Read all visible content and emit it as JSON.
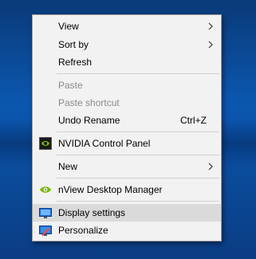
{
  "menu": {
    "items": [
      {
        "label": "View"
      },
      {
        "label": "Sort by"
      },
      {
        "label": "Refresh"
      },
      {
        "label": "Paste"
      },
      {
        "label": "Paste shortcut"
      },
      {
        "label": "Undo Rename",
        "shortcut": "Ctrl+Z"
      },
      {
        "label": "NVIDIA Control Panel",
        "icon": "nvidia-icon"
      },
      {
        "label": "New"
      },
      {
        "label": "nView Desktop Manager",
        "icon": "nvidia-icon"
      },
      {
        "label": "Display settings",
        "icon": "display-icon"
      },
      {
        "label": "Personalize",
        "icon": "personalize-icon"
      }
    ]
  },
  "colors": {
    "desktop": "#0b57b0",
    "menu_bg": "#f2f2f2",
    "highlight": "#dadada",
    "disabled_text": "#8a8a8a",
    "nvidia_green": "#76b900"
  }
}
